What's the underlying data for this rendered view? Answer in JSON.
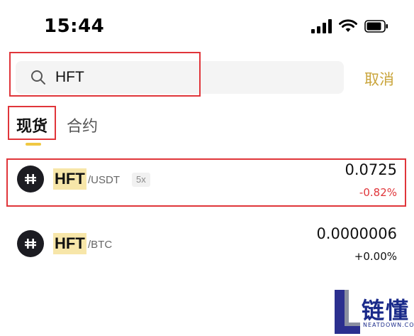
{
  "status_bar": {
    "time": "15:44"
  },
  "search": {
    "value": "HFT",
    "placeholder": "",
    "cancel_label": "取消"
  },
  "tabs": [
    {
      "label": "现货",
      "active": true
    },
    {
      "label": "合约",
      "active": false
    }
  ],
  "pairs": [
    {
      "base": "HFT",
      "quote": "/USDT",
      "leverage": "5x",
      "price": "0.0725",
      "change": "-0.82%",
      "change_color": "#e0353a"
    },
    {
      "base": "HFT",
      "quote": "/BTC",
      "price": "0.0000006",
      "change": "+0.00%",
      "change_color": "#111111"
    }
  ],
  "watermark": {
    "text_cn": "链懂",
    "text_en": "NEATDOWN.COM"
  },
  "colors": {
    "accent": "#c9a43a",
    "highlight": "#f7e6a9",
    "annotation_red": "#e0353a",
    "negative": "#e0353a"
  }
}
